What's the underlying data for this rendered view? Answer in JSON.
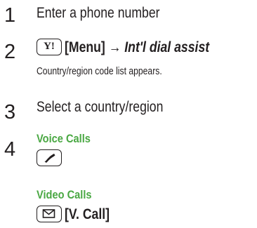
{
  "steps": [
    {
      "number": "1",
      "text": "Enter a phone number"
    },
    {
      "number": "2",
      "key_glyph": "Y!",
      "key_icon": "yahoo-key-icon",
      "menu_label": "[Menu]",
      "arrow": "→",
      "target": "Int'l dial assist",
      "note": "Country/region code list appears."
    },
    {
      "number": "3",
      "text": "Select a country/region"
    },
    {
      "number": "4",
      "voice_heading": "Voice Calls",
      "voice_key_icon": "call-key-icon",
      "video_heading": "Video Calls",
      "video_key_icon": "mail-key-icon",
      "video_label": "[V. Call]"
    }
  ],
  "colors": {
    "text": "#231f20",
    "accent_green": "#4aa843"
  }
}
